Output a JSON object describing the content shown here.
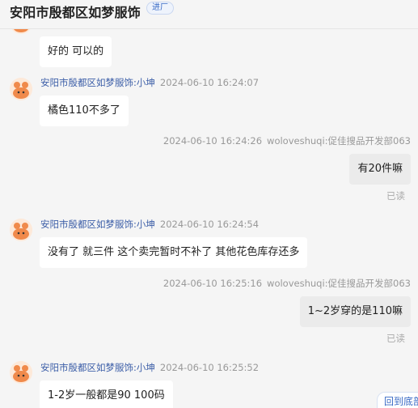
{
  "header": {
    "title": "安阳市殷都区如梦服饰",
    "badge": "进厂"
  },
  "messages": [
    {
      "text": "好的 可以的"
    },
    {
      "sender": "安阳市殷都区如梦服饰:小坤",
      "time": "2024-06-10 16:24:07",
      "text": "橘色110不多了"
    },
    {
      "sender": "woloveshuqi:促佳搜品开发部063",
      "time": "2024-06-10 16:24:26",
      "text": "有20件嘛",
      "status": "已读"
    },
    {
      "sender": "安阳市殷都区如梦服饰:小坤",
      "time": "2024-06-10 16:24:54",
      "text": "没有了 就三件 这个卖完暂时不补了 其他花色库存还多"
    },
    {
      "sender": "woloveshuqi:促佳搜品开发部063",
      "time": "2024-06-10 16:25:16",
      "text": "1~2岁穿的是110嘛",
      "status": "已读"
    },
    {
      "sender": "安阳市殷都区如梦服饰:小坤",
      "time": "2024-06-10 16:25:52",
      "text": "1-2岁一般都是90 100码"
    }
  ],
  "back_to_bottom": "回到底部",
  "colors": {
    "sender_link": "#3d5fa8",
    "badge": "#3a6bc5",
    "outgoing_bubble": "#ebebeb"
  },
  "icons": {
    "avatar": "cartoon-dog-avatar-icon"
  }
}
